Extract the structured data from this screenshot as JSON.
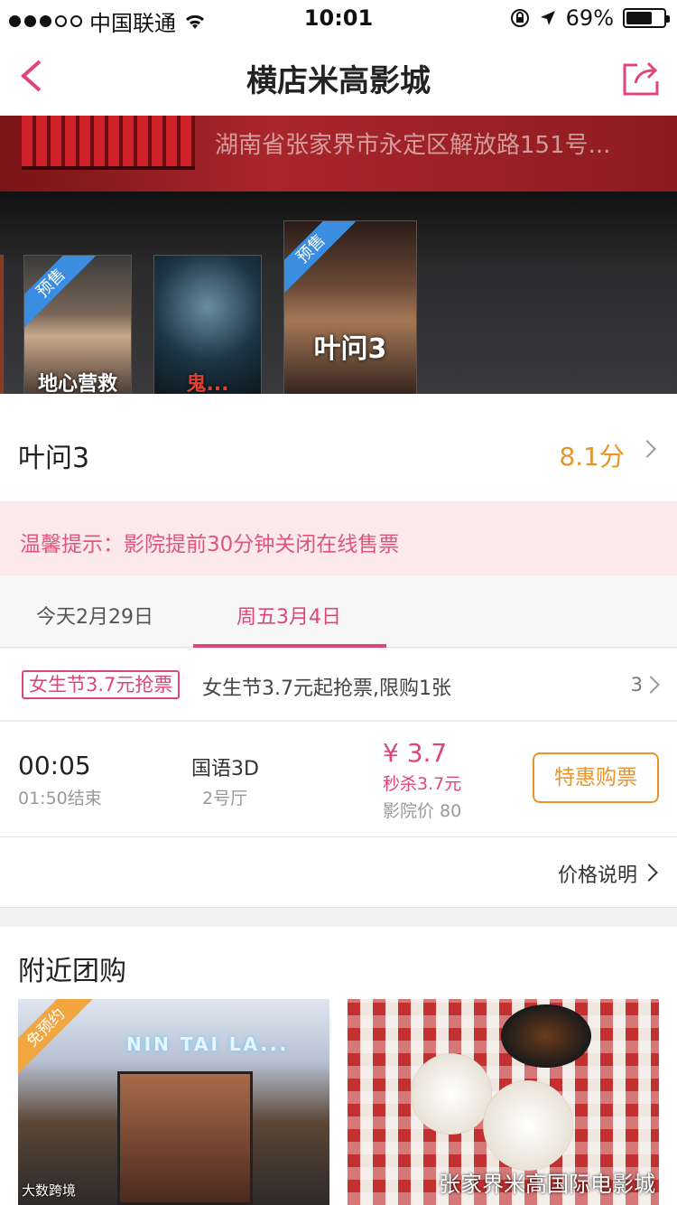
{
  "status_bar": {
    "carrier": "中国联通",
    "time": "10:01",
    "battery": "69%",
    "battery_level": 0.69
  },
  "nav": {
    "title": "横店米高影城"
  },
  "cinema": {
    "address": "湖南省张家界市永定区解放路151号..."
  },
  "posters": [
    {
      "ribbon": "预售",
      "text": "地心营救"
    },
    {
      "ribbon": "",
      "text": "鬼..."
    },
    {
      "ribbon": "预售",
      "text": "叶问3"
    }
  ],
  "movie": {
    "name": "叶问3",
    "score": "8.1分"
  },
  "notice": {
    "text": "温馨提示：影院提前30分钟关闭在线售票"
  },
  "date_tabs": [
    {
      "label": "今天2月29日",
      "active": false
    },
    {
      "label": "周五3月4日",
      "active": true
    }
  ],
  "promo": {
    "tag": "女生节3.7元抢票",
    "description": "女生节3.7元起抢票,限购1张",
    "count": "3"
  },
  "showtime": {
    "start": "00:05",
    "end": "01:50结束",
    "language": "国语3D",
    "hall": "2号厅",
    "price": "¥ 3.7",
    "sale": "秒杀3.7元",
    "cinema_price": "影院价 80",
    "button": "特惠购票"
  },
  "price_explain": {
    "label": "价格说明"
  },
  "nearby": {
    "title": "附近团购",
    "deals": [
      {
        "corner_tag": "免预约",
        "sign": "NIN TAI LA..."
      },
      {
        "corner_tag": ""
      }
    ],
    "watermark": "张家界米高国际电影城",
    "watermark_small": "大数跨境"
  },
  "colors": {
    "accent_pink": "#e0457a",
    "accent_orange": "#e8942a"
  }
}
